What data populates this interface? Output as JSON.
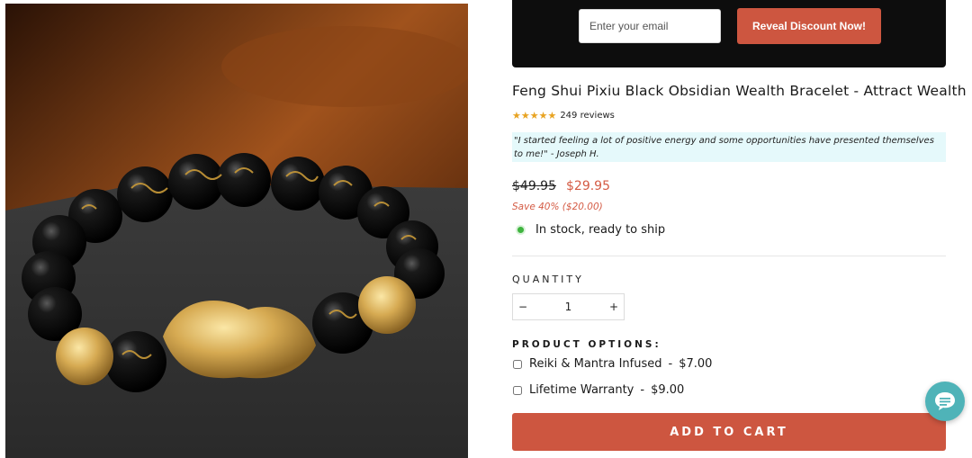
{
  "product": {
    "image_alt": "Black obsidian bead bracelet with gold pixiu charm",
    "title": "Feng Shui Pixiu Black Obsidian Wealth Bracelet - Attract Wealth",
    "rating": {
      "stars": "★★★★★",
      "review_count": "249 reviews"
    },
    "testimonial": "\"I started feeling a lot of positive energy and some opportunities have presented themselves to me!\" - Joseph H.",
    "compare_price": "$49.95",
    "sale_price": "$29.95",
    "save_text": "Save 40% ($20.00)",
    "stock_text": "In stock, ready to ship"
  },
  "email_banner": {
    "placeholder": "Enter your email",
    "button_label": "Reveal Discount Now!"
  },
  "quantity": {
    "label": "QUANTITY",
    "minus": "−",
    "value": "1",
    "plus": "+"
  },
  "options": {
    "label": "PRODUCT OPTIONS:",
    "items": [
      {
        "name": "Reiki & Mantra Infused",
        "sep": "-",
        "price": "$7.00"
      },
      {
        "name": "Lifetime Warranty",
        "sep": "-",
        "price": "$9.00"
      }
    ]
  },
  "cart": {
    "button_label": "ADD TO CART"
  },
  "colors": {
    "accent": "#cd5640",
    "sale": "#d45b44",
    "stock": "#3fb43f",
    "testimonial_bg": "#e5f9fb",
    "chat": "#4fb3b8"
  },
  "icons": {
    "chat": "chat-bubble-icon",
    "stock": "status-dot-icon"
  }
}
